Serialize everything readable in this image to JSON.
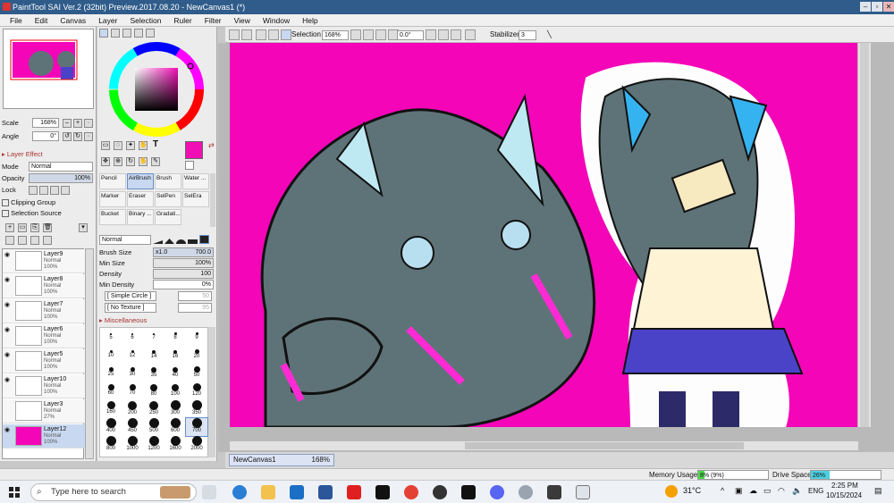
{
  "window": {
    "title": "PaintTool SAI Ver.2 (32bit) Preview.2017.08.20 - NewCanvas1 (*)"
  },
  "menu": [
    "File",
    "Edit",
    "Canvas",
    "Layer",
    "Selection",
    "Ruler",
    "Filter",
    "View",
    "Window",
    "Help"
  ],
  "navigator": {
    "scale_label": "Scale",
    "scale_value": "168%",
    "angle_label": "Angle",
    "angle_value": "0°"
  },
  "layer_effect": {
    "header": "Layer Effect",
    "mode_label": "Mode",
    "mode_value": "Normal",
    "opacity_label": "Opacity",
    "opacity_value": "100%",
    "lock_label": "Lock",
    "clipping_label": "Clipping Group",
    "selection_source_label": "Selection Source"
  },
  "layers": [
    {
      "name": "Layer9",
      "mode": "Normal",
      "opacity": "100%"
    },
    {
      "name": "Layer8",
      "mode": "Normal",
      "opacity": "100%"
    },
    {
      "name": "Layer7",
      "mode": "Normal",
      "opacity": "100%"
    },
    {
      "name": "Layer6",
      "mode": "Normal",
      "opacity": "100%"
    },
    {
      "name": "Layer5",
      "mode": "Normal",
      "opacity": "100%"
    },
    {
      "name": "Layer10",
      "mode": "Normal",
      "opacity": "100%"
    },
    {
      "name": "Layer3",
      "mode": "Normal",
      "opacity": "27%"
    },
    {
      "name": "Layer12",
      "mode": "Normal",
      "opacity": "100%",
      "selected": true
    }
  ],
  "tools": [
    [
      "Pencil",
      "AirBrush",
      "Brush",
      "Water ..."
    ],
    [
      "Marker",
      "Eraser",
      "SelPen",
      "SelEra"
    ],
    [
      "Bucket",
      "Binary ...",
      "Gradati..."
    ]
  ],
  "brush": {
    "mode_value": "Normal",
    "size_label": "Brush Size",
    "size_mult": "x1.0",
    "size_value": "700.0",
    "min_size_label": "Min Size",
    "min_size_value": "100%",
    "density_label": "Density",
    "density_value": "100",
    "min_density_label": "Min Density",
    "min_density_value": "0%",
    "shape_label": "[ Simple Circle ]",
    "shape_value": "50",
    "texture_label": "[ No Texture ]",
    "texture_value": "95",
    "misc_label": "Miscellaneous",
    "sizes": [
      "5",
      "6",
      "7",
      "8",
      "9",
      "10",
      "12",
      "14",
      "16",
      "20",
      "25",
      "30",
      "35",
      "40",
      "50",
      "60",
      "70",
      "80",
      "100",
      "120",
      "160",
      "200",
      "250",
      "300",
      "350",
      "400",
      "450",
      "500",
      "600",
      "700",
      "800",
      "1000",
      "1200",
      "1600",
      "2000"
    ]
  },
  "toolbar": {
    "selection_label": "Selection",
    "zoom_value": "168%",
    "angle_value": "0.0°",
    "stabilizer_label": "Stabilizer",
    "stabilizer_value": "3"
  },
  "canvas_tab": {
    "name": "NewCanvas1",
    "zoom": "168%"
  },
  "status": {
    "memory_label": "Memory Usage",
    "memory_value": "8% (9%)",
    "drive_label": "Drive Space",
    "drive_value": "26%"
  },
  "taskbar": {
    "search_placeholder": "Type here to search",
    "weather": "31°C",
    "lang": "ENG",
    "time": "2:25 PM",
    "date": "10/15/2024"
  },
  "colors": {
    "primary": "#f00fb4",
    "canvas_bg": "#f405b8",
    "titlebar": "#2f5c8a"
  }
}
